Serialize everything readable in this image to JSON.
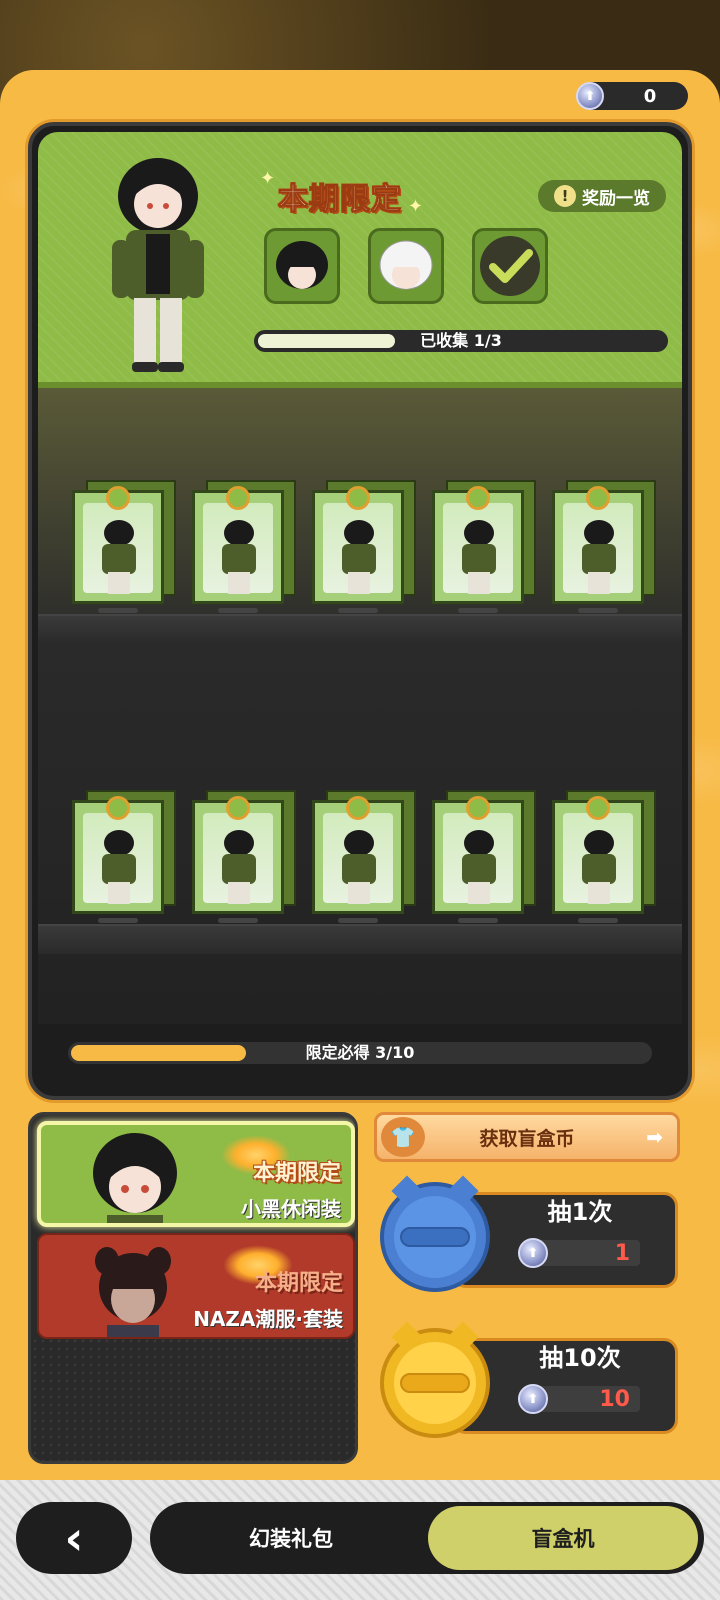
{
  "currency": {
    "amount": "0",
    "icon": "blind-box-coin-icon"
  },
  "banner": {
    "title": "本期限定",
    "rewards_button": "奖励一览",
    "collection_progress": "已收集 1/3",
    "collected": 1,
    "total": 3,
    "reward_items": [
      {
        "name": "black-hair-piece",
        "collected": false
      },
      {
        "name": "white-hair-piece",
        "collected": false
      },
      {
        "name": "jacket-piece",
        "collected": true
      }
    ]
  },
  "shelves": {
    "row1_count": 5,
    "row2_count": 5
  },
  "guarantee": {
    "label": "限定必得 3/10",
    "current": 3,
    "total": 10
  },
  "pools": [
    {
      "tag": "本期限定",
      "name": "小黑休闲装",
      "selected": true
    },
    {
      "tag": "本期限定",
      "name": "NAZA潮服·套装",
      "selected": false
    }
  ],
  "get_coins_button": "获取盲盒币",
  "draw_once": {
    "label": "抽1次",
    "cost": "1"
  },
  "draw_ten": {
    "label": "抽10次",
    "cost": "10"
  },
  "bottom_tabs": {
    "back_icon": "chevron-left-icon",
    "tab1": "幻装礼包",
    "tab2": "盲盒机"
  },
  "colors": {
    "panel": "#f7ba45",
    "banner_green": "#8fbb47",
    "accent_red": "#ff5a4a",
    "tab_active": "#cfd06a"
  }
}
